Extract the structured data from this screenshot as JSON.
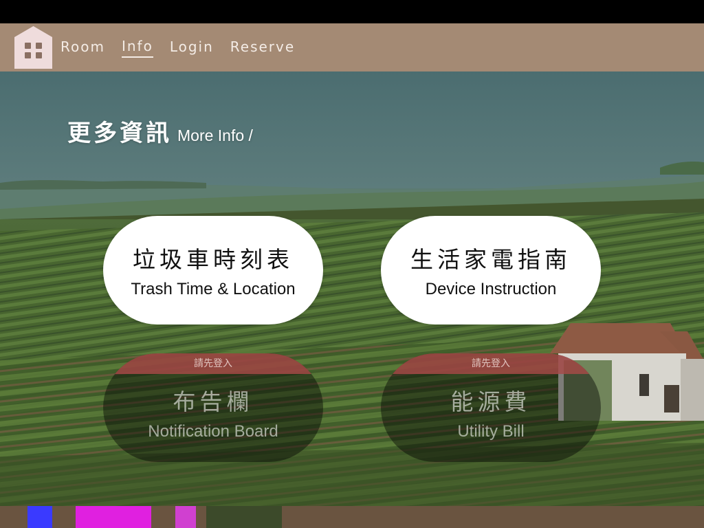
{
  "nav": {
    "links": [
      "Room",
      "Info",
      "Login",
      "Reserve"
    ],
    "active": "Info"
  },
  "heading": {
    "zh": "更多資訊",
    "en": "More Info /"
  },
  "cards": [
    {
      "zh": "垃圾車時刻表",
      "en": "Trash Time & Location",
      "locked": false
    },
    {
      "zh": "生活家電指南",
      "en": "Device Instruction",
      "locked": false
    },
    {
      "zh": "布告欄",
      "en": "Notification Board",
      "locked": true,
      "badge": "請先登入"
    },
    {
      "zh": "能源費",
      "en": "Utility Bill",
      "locked": true,
      "badge": "請先登入"
    }
  ],
  "colors": {
    "navbar": "#a48a74",
    "nav_text": "#f4ece6",
    "logo_bg": "#efdcdc",
    "badge": "#a84a48"
  },
  "icons": {
    "logo": "house-icon"
  }
}
